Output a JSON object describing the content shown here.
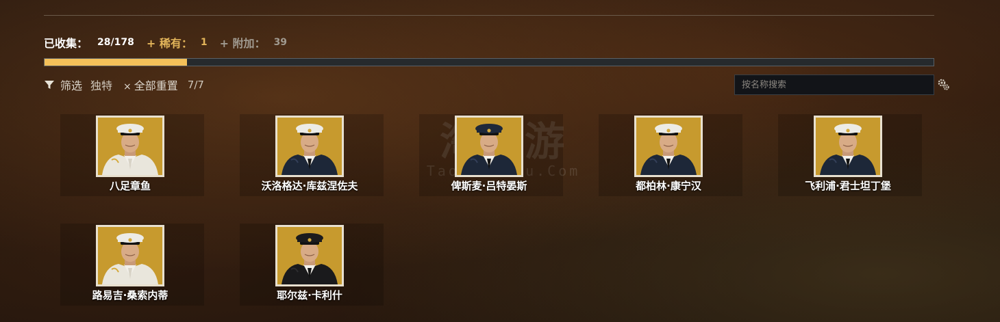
{
  "stats": {
    "collected_label": "已收集：",
    "collected_value": "28/178",
    "rare_label": "+ 稀有：",
    "rare_value": "1",
    "extra_label": "+ 附加：",
    "extra_value": "39",
    "progress_fraction": 0.16
  },
  "filter": {
    "filter_label": "筛选",
    "unique_label": "独特",
    "reset_x": "×",
    "reset_label": "全部重置",
    "count": "7/7"
  },
  "search": {
    "placeholder": "按名称搜索"
  },
  "watermark": {
    "main": "淘手游",
    "sub": "TaoShouYou.Com"
  },
  "colors": {
    "accent": "#f4c15a",
    "rare": "#e3b55a",
    "portrait_bg": "#c79a2e"
  },
  "commanders": [
    {
      "name": "八足章鱼",
      "uniform": "white",
      "cap": "white"
    },
    {
      "name": "沃洛格达·库兹涅佐夫",
      "uniform": "navy",
      "cap": "white"
    },
    {
      "name": "俾斯麦·吕特晏斯",
      "uniform": "navy",
      "cap": "navy"
    },
    {
      "name": "都柏林·康宁汉",
      "uniform": "navy",
      "cap": "white"
    },
    {
      "name": "飞利浦·君士坦丁堡",
      "uniform": "navy",
      "cap": "white"
    },
    {
      "name": "路易吉·桑索内蒂",
      "uniform": "white",
      "cap": "white"
    },
    {
      "name": "耶尔兹·卡利什",
      "uniform": "black",
      "cap": "black"
    }
  ]
}
